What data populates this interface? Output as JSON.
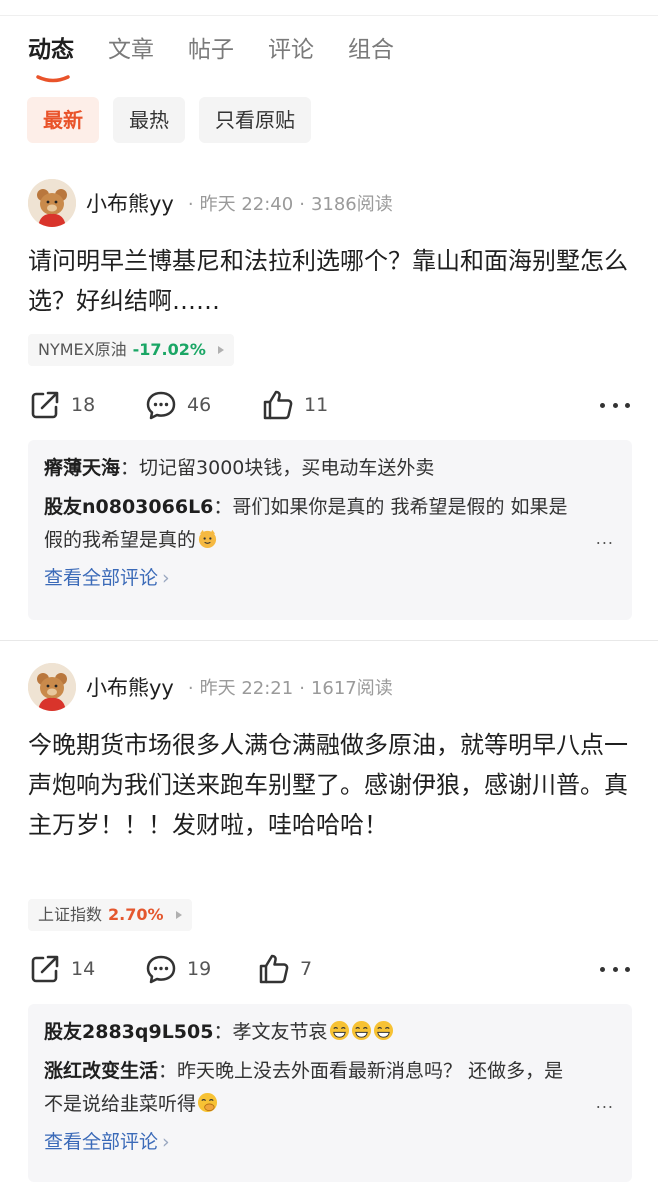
{
  "tabs": [
    "动态",
    "文章",
    "帖子",
    "评论",
    "组合"
  ],
  "filters": [
    "最新",
    "最热",
    "只看原贴"
  ],
  "colors": {
    "accent": "#e9532a",
    "rise": "#e4572e",
    "fall": "#1aa665",
    "link": "#3b6ab8"
  },
  "posts": [
    {
      "author": "小布熊yy",
      "time": "昨天 22:40",
      "reads": "3186阅读",
      "content": "请问明早兰博基尼和法拉利选哪个？靠山和面海别墅怎么选？好纠结啊……",
      "stock": {
        "name": "NYMEX原油",
        "change": "-17.02%"
      },
      "shares": "18",
      "comments_count": "46",
      "likes": "11",
      "comments": [
        {
          "name": "瘠薄天海",
          "text": "切记留3000块钱，买电动车送外卖"
        },
        {
          "name": "股友n0803066L6",
          "text": "哥们如果你是真的 我希望是假的 如果是假的我希望是真的"
        }
      ],
      "view_all": "查看全部评论"
    },
    {
      "author": "小布熊yy",
      "time": "昨天 22:21",
      "reads": "1617阅读",
      "content": "今晚期货市场很多人满仓满融做多原油，就等明早八点一声炮响为我们送来跑车别墅了。感谢伊狼，感谢川普。真主万岁！！！发财啦，哇哈哈哈！",
      "stock": {
        "name": "上证指数",
        "change": "2.70%"
      },
      "shares": "14",
      "comments_count": "19",
      "likes": "7",
      "comments": [
        {
          "name": "股友2883q9L505",
          "text": "孝文友节哀"
        },
        {
          "name": "涨红改变生活",
          "text": "昨天晚上没去外面看最新消息吗？ 还做多，是不是说给韭菜听得"
        }
      ],
      "view_all": "查看全部评论"
    }
  ],
  "icons": {
    "share": "share-icon",
    "comment": "comment-icon",
    "like": "thumbs-up-icon",
    "more": "more-dots-icon",
    "emoji": "emoji-icon"
  }
}
